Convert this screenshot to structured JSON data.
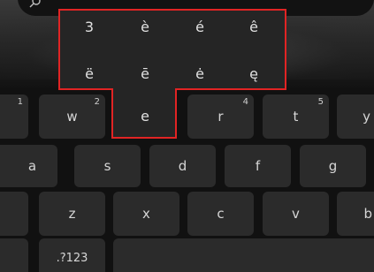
{
  "accent_popup": {
    "row1": [
      "3",
      "è",
      "é",
      "ê"
    ],
    "row2": [
      "ë",
      "ē",
      "ė",
      "ę"
    ],
    "base": "e"
  },
  "keyboard": {
    "row1": [
      {
        "label": "",
        "hint": "1"
      },
      {
        "label": "w",
        "hint": "2"
      },
      {
        "label": "r",
        "hint": "4"
      },
      {
        "label": "t",
        "hint": "5"
      },
      {
        "label": "y",
        "hint": ""
      }
    ],
    "row2": [
      "a",
      "s",
      "d",
      "f",
      "g"
    ],
    "row3": [
      "z",
      "x",
      "c",
      "v",
      "b"
    ],
    "symbols_label": ".?123"
  },
  "colors": {
    "highlight": "#e12424",
    "key_bg": "#2b2b2b",
    "keyboard_bg": "#111111"
  }
}
